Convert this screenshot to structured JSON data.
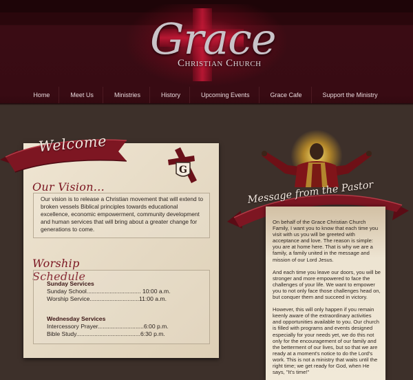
{
  "logo": {
    "title": "Grace",
    "subtitle": "Christian Church"
  },
  "nav": [
    "Home",
    "Meet Us",
    "Ministries",
    "History",
    "Upcoming Events",
    "Grace Cafe",
    "Support the Ministry"
  ],
  "welcome": {
    "ribbon": "Welcome"
  },
  "vision": {
    "title": "Our Vision...",
    "text": "Our vision is to release a Christian movement that will extend to broken vessels Biblical principles towards educational excellence, economic empowerment, community development and human services that will bring about a greater change for generations to come."
  },
  "worship": {
    "title": "Worship Schedule",
    "sunday_head": "Sunday Services",
    "sunday": [
      "Sunday School................................. 10:00 a.m.",
      "Worship Service..............................11:00 a.m."
    ],
    "wednesday_head": "Wednesday Services",
    "wednesday": [
      "Intercessory Prayer............................6:00 p.m.",
      "Bible Study.......................................6:30 p.m."
    ]
  },
  "pastor": {
    "ribbon": "Message from the Pastor",
    "paragraphs": [
      "On behalf of the Grace Christian Church Family, I want you to know that each time you visit with us you will be greeted with acceptance and love. The reason is simple: you are at home here. That is why we are a family, a family united in the message and mission of our Lord Jesus.",
      "And each time you leave our doors, you will be stronger and more empowered to face the challenges of your life. We want to empower you to not only face those challenges head on, but conquer them and succeed in victory.",
      "However, this will only happen if you remain keenly aware of the extraordinary activities and opportunities available to you. Our church is filled with programs and events designed especially for your needs yet, we do this not only for the encouragement of our family and the betterment of our lives, but so that we are ready at a moment's notice to do the Lord's work. This is not a ministry that waits until the right time; we get ready for God, when He says, \"It's time!\""
    ]
  },
  "colors": {
    "maroon": "#7a1420",
    "header": "#380b13",
    "page": "#3d302a",
    "parchment": "#e9dfcb"
  }
}
